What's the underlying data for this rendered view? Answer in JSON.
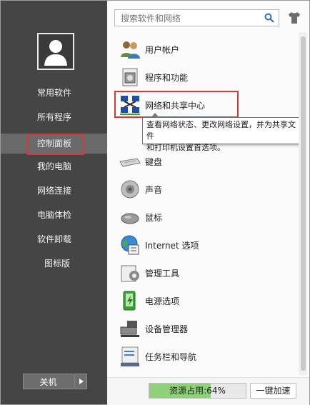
{
  "search": {
    "placeholder": "搜索软件和网络"
  },
  "sidebar": {
    "items": [
      {
        "label": "常用软件"
      },
      {
        "label": "所有程序"
      },
      {
        "label": "控制面板"
      },
      {
        "label": "我的电脑"
      },
      {
        "label": "网络连接"
      },
      {
        "label": "电脑体检"
      },
      {
        "label": "软件卸载"
      },
      {
        "label": "图标版"
      }
    ],
    "active_index": 2,
    "shutdown_label": "关机"
  },
  "panel": {
    "items": [
      {
        "label": "用户帐户",
        "icon": "users-icon"
      },
      {
        "label": "程序和功能",
        "icon": "programs-icon"
      },
      {
        "label": "网络和共享中心",
        "icon": "network-icon"
      },
      {
        "label": "键盘",
        "icon": "keyboard-icon"
      },
      {
        "label": "声音",
        "icon": "speaker-icon"
      },
      {
        "label": "鼠标",
        "icon": "mouse-icon"
      },
      {
        "label": "Internet 选项",
        "icon": "internet-icon"
      },
      {
        "label": "管理工具",
        "icon": "admin-tools-icon"
      },
      {
        "label": "电源选项",
        "icon": "power-icon"
      },
      {
        "label": "设备管理器",
        "icon": "device-manager-icon"
      },
      {
        "label": "任务栏和导航",
        "icon": "taskbar-icon"
      }
    ],
    "tooltip": {
      "line1": "查看网络状态、更改网络设置，并为共享文件",
      "line2": "和打印机设置首选项。"
    }
  },
  "footer": {
    "resource_label": "资源占用:64%",
    "resource_percent": 64,
    "accelerate_label": "一键加速"
  },
  "colors": {
    "highlight_red": "#d13b3b",
    "resource_green": "#8fd07a",
    "sidebar_bg": "#454545"
  }
}
